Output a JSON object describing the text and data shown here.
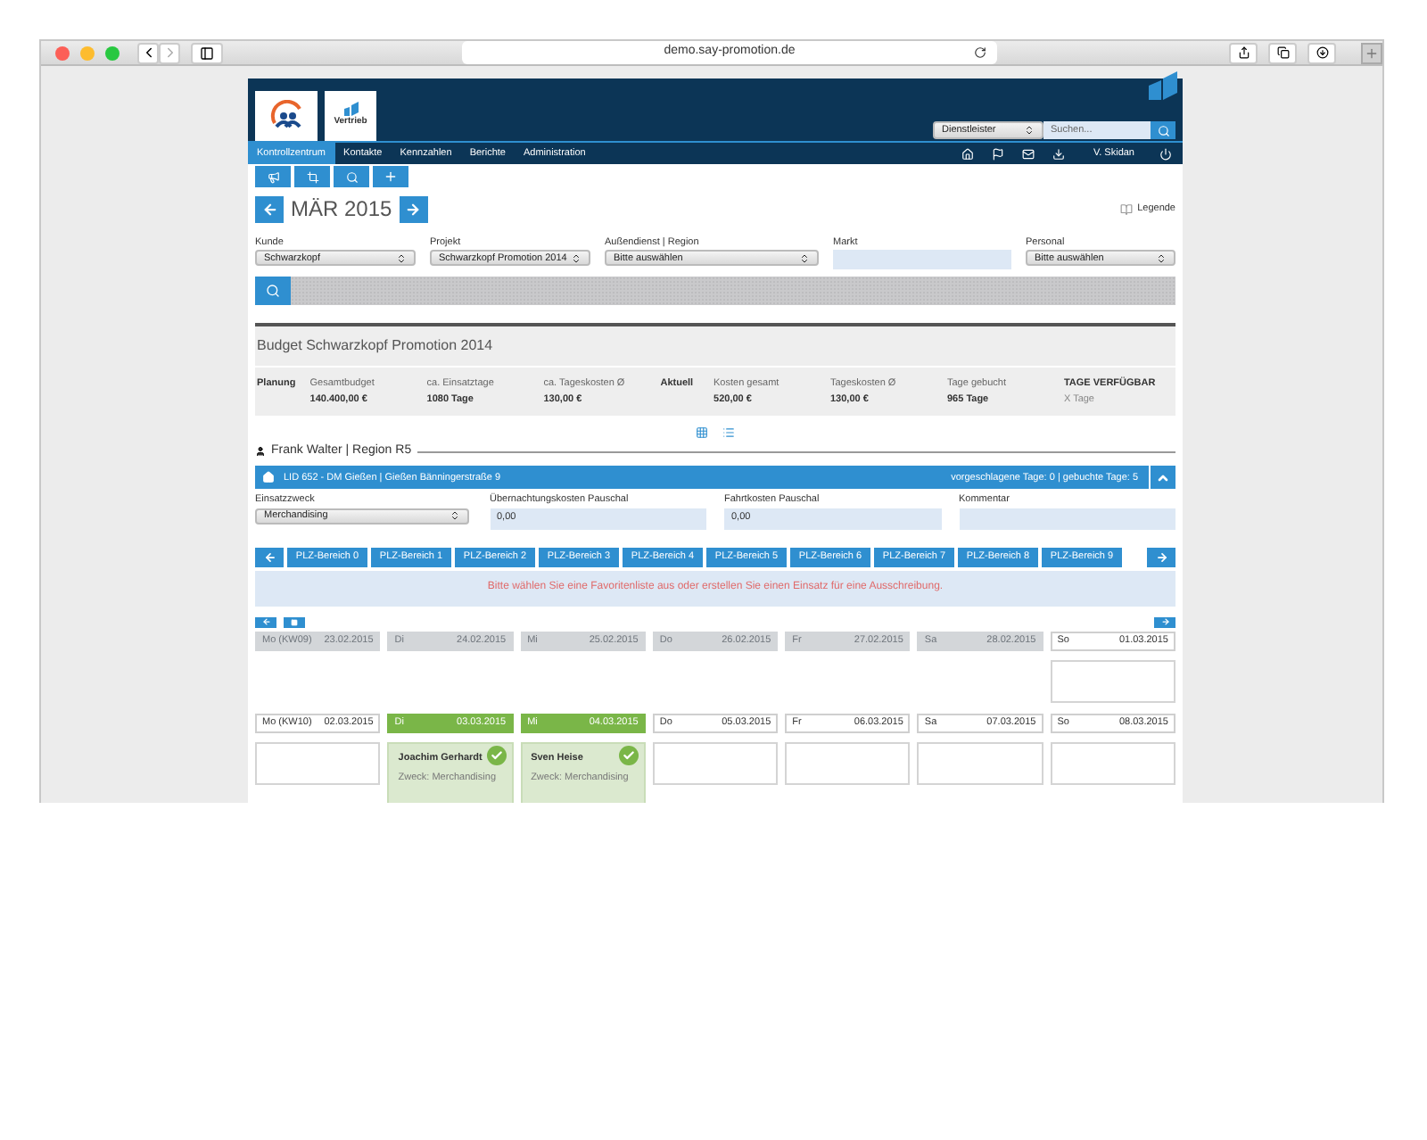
{
  "browser": {
    "url": "demo.say-promotion.de"
  },
  "header": {
    "logo_text": "Vertrieb",
    "scope_select": "Dienstleister",
    "search_placeholder": "Suchen...",
    "user": "V. Skidan"
  },
  "nav": [
    {
      "label": "Kontrollzentrum",
      "selected": true
    },
    {
      "label": "Kontakte",
      "selected": false
    },
    {
      "label": "Kennzahlen",
      "selected": false
    },
    {
      "label": "Berichte",
      "selected": false
    },
    {
      "label": "Administration",
      "selected": false
    }
  ],
  "month": "MÄR 2015",
  "legend": "Legende",
  "filters": [
    {
      "label": "Kunde",
      "value": "Schwarzkopf",
      "kind": "select"
    },
    {
      "label": "Projekt",
      "value": "Schwarzkopf Promotion 2014",
      "kind": "select"
    },
    {
      "label": "Außendienst | Region",
      "value": "Bitte auswählen",
      "kind": "select"
    },
    {
      "label": "Markt",
      "kind": "input"
    },
    {
      "label": "Personal",
      "value": "Bitte auswählen",
      "kind": "select"
    }
  ],
  "budget": {
    "title": "Budget Schwarzkopf Promotion 2014",
    "items": [
      {
        "kind": "heading",
        "label": "Planung"
      },
      {
        "kind": "stat",
        "label": "Gesamtbudget",
        "value": "140.400,00 €"
      },
      {
        "kind": "stat",
        "label": "ca. Einsatztage",
        "value": "1080 Tage"
      },
      {
        "kind": "stat",
        "label": "ca. Tageskosten Ø",
        "value": "130,00 €"
      },
      {
        "kind": "heading",
        "label": "Aktuell"
      },
      {
        "kind": "stat",
        "label": "Kosten gesamt",
        "value": "520,00 €"
      },
      {
        "kind": "stat",
        "label": "Tageskosten Ø",
        "value": "130,00 €"
      },
      {
        "kind": "stat",
        "label": "Tage gebucht",
        "value": "965 Tage"
      },
      {
        "kind": "stat_inverse",
        "label": "TAGE VERFÜGBAR",
        "value": "X Tage"
      }
    ]
  },
  "person": "Frank Walter | Region R5",
  "location": {
    "title": "LID 652 - DM Gießen | Gießen Bänningerstraße 9",
    "days": "vorgeschlagene Tage: 0 | gebuchte Tage: 5"
  },
  "fields": [
    {
      "label": "Einsatzzweck",
      "value": "Merchandising",
      "kind": "select"
    },
    {
      "label": "Übernachtungskosten Pauschal",
      "value": "0,00",
      "kind": "input"
    },
    {
      "label": "Fahrtkosten Pauschal",
      "value": "0,00",
      "kind": "input"
    },
    {
      "label": "Kommentar",
      "kind": "input"
    }
  ],
  "plz_tabs": [
    "PLZ-Bereich 0",
    "PLZ-Bereich 1",
    "PLZ-Bereich 2",
    "PLZ-Bereich 3",
    "PLZ-Bereich 4",
    "PLZ-Bereich 5",
    "PLZ-Bereich 6",
    "PLZ-Bereich 7",
    "PLZ-Bereich 8",
    "PLZ-Bereich 9"
  ],
  "message": "Bitte wählen Sie eine Favoritenliste aus oder erstellen Sie einen Einsatz für eine Ausschreibung.",
  "weeks": [
    {
      "days": [
        {
          "weekday": "Mo (KW09)",
          "date": "23.02.2015",
          "kind": "past"
        },
        {
          "weekday": "Di",
          "date": "24.02.2015",
          "kind": "past"
        },
        {
          "weekday": "Mi",
          "date": "25.02.2015",
          "kind": "past"
        },
        {
          "weekday": "Do",
          "date": "26.02.2015",
          "kind": "past"
        },
        {
          "weekday": "Fr",
          "date": "27.02.2015",
          "kind": "past"
        },
        {
          "weekday": "Sa",
          "date": "28.02.2015",
          "kind": "past"
        },
        {
          "weekday": "So",
          "date": "01.03.2015",
          "kind": "normal"
        }
      ]
    },
    {
      "days": [
        {
          "weekday": "Mo (KW10)",
          "date": "02.03.2015",
          "kind": "normal"
        },
        {
          "weekday": "Di",
          "date": "03.03.2015",
          "kind": "booked",
          "entry": {
            "name": "Joachim Gerhardt",
            "purpose": "Zweck: Merchandising"
          }
        },
        {
          "weekday": "Mi",
          "date": "04.03.2015",
          "kind": "booked",
          "entry": {
            "name": "Sven Heise",
            "purpose": "Zweck: Merchandising"
          }
        },
        {
          "weekday": "Do",
          "date": "05.03.2015",
          "kind": "normal"
        },
        {
          "weekday": "Fr",
          "date": "06.03.2015",
          "kind": "normal"
        },
        {
          "weekday": "Sa",
          "date": "07.03.2015",
          "kind": "normal"
        },
        {
          "weekday": "So",
          "date": "08.03.2015",
          "kind": "normal"
        }
      ]
    }
  ]
}
